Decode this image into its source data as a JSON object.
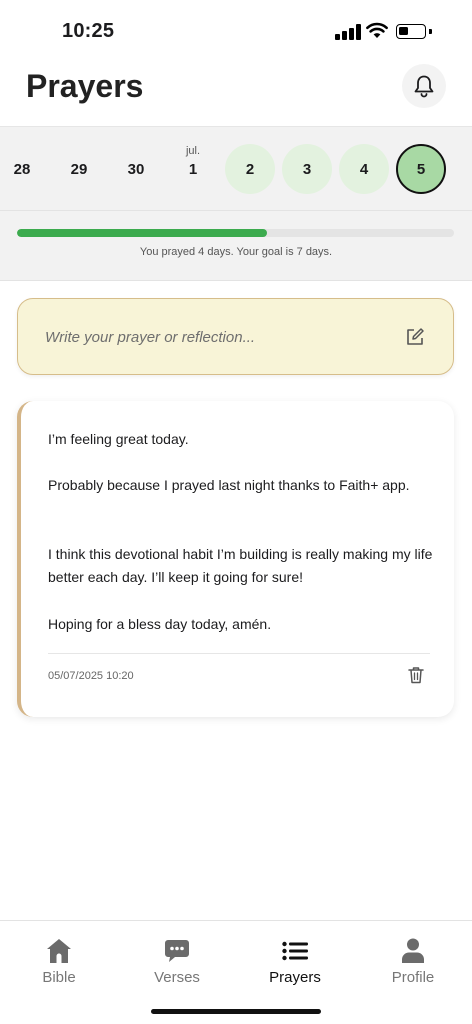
{
  "status_bar": {
    "time": "10:25"
  },
  "header": {
    "title": "Prayers"
  },
  "calendar": {
    "days": [
      {
        "number": "28",
        "month": "",
        "state": "none"
      },
      {
        "number": "29",
        "month": "",
        "state": "none"
      },
      {
        "number": "30",
        "month": "",
        "state": "none"
      },
      {
        "number": "1",
        "month": "jul.",
        "state": "none"
      },
      {
        "number": "2",
        "month": "",
        "state": "prayed"
      },
      {
        "number": "3",
        "month": "",
        "state": "prayed"
      },
      {
        "number": "4",
        "month": "",
        "state": "prayed"
      },
      {
        "number": "5",
        "month": "",
        "state": "today"
      }
    ]
  },
  "progress": {
    "fraction": 0.571,
    "text": "You prayed 4 days. Your goal is 7 days.",
    "color": "#3cab4e"
  },
  "prayer_input": {
    "placeholder": "Write your prayer or reflection...",
    "icon": "edit-icon"
  },
  "entry": {
    "paragraphs": [
      "I’m feeling great today.",
      "Probably because I prayed last night thanks to Faith+ app.",
      "I think this devotional habit I’m building is really making my life better each day. I’ll keep it going for sure!",
      "Hoping for a bless day today, amén."
    ],
    "date": "05/07/2025 10:20",
    "accent_color": "#d4b588"
  },
  "tabs": [
    {
      "label": "Bible",
      "icon": "church-icon",
      "active": false
    },
    {
      "label": "Verses",
      "icon": "chat-bubble-icon",
      "active": false
    },
    {
      "label": "Prayers",
      "icon": "list-icon",
      "active": true
    },
    {
      "label": "Profile",
      "icon": "person-icon",
      "active": false
    }
  ]
}
